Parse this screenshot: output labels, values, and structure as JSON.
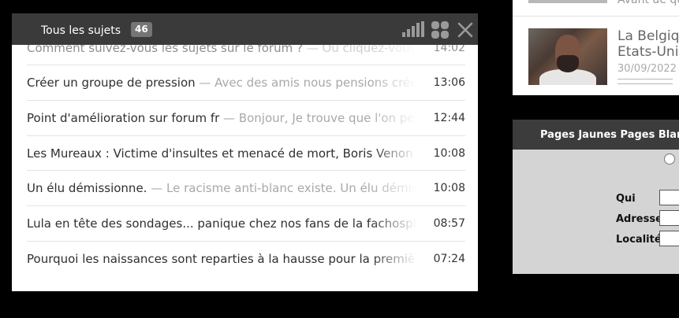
{
  "popup": {
    "title": "Tous les sujets",
    "count": "46",
    "icons": {
      "stats": "bar-chart-icon",
      "grid": "grid-icon",
      "close": "close-icon"
    },
    "topics": [
      {
        "title": "Comment suivez-vous les sujets sur le forum ?",
        "excerpt": " — Ou cliquez-vous ? Pa",
        "time": "14:02"
      },
      {
        "title": "Créer un groupe de pression",
        "excerpt": " — Avec des amis nous pensions créer un",
        "time": "13:06"
      },
      {
        "title": "Point d'amélioration sur forum fr",
        "excerpt": " — Bonjour, Je trouve que l'on perd tr",
        "time": "12:44"
      },
      {
        "title": "Les Mureaux : Victime d'insultes et menacé de mort, Boris Venon démi",
        "excerpt": "",
        "time": "10:08"
      },
      {
        "title": "Un élu démissionne.",
        "excerpt": " — Le racisme anti-blanc existe. Un élu démission",
        "time": "10:08"
      },
      {
        "title": "Lula en tête des sondages... panique chez nos fans de la fachosphère",
        "excerpt": "",
        "time": "08:57"
      },
      {
        "title": "Pourquoi les naissances sont reparties à la hausse pour la première fo",
        "excerpt": "",
        "time": "07:24"
      }
    ]
  },
  "news": {
    "top_text": "Avant de qu",
    "title_line1": "La Belgiqu",
    "title_line2": "Etats-Unis",
    "date": "30/09/2022"
  },
  "pages_jaunes": {
    "header": "Pages Jaunes Pages Blanches",
    "labels": {
      "qui": "Qui",
      "adresse": "Adresse",
      "localite": "Localité"
    }
  },
  "colors": {
    "header_bg": "#3a3a3a",
    "badge_bg": "#757575",
    "excerpt": "#a8a8a8"
  }
}
